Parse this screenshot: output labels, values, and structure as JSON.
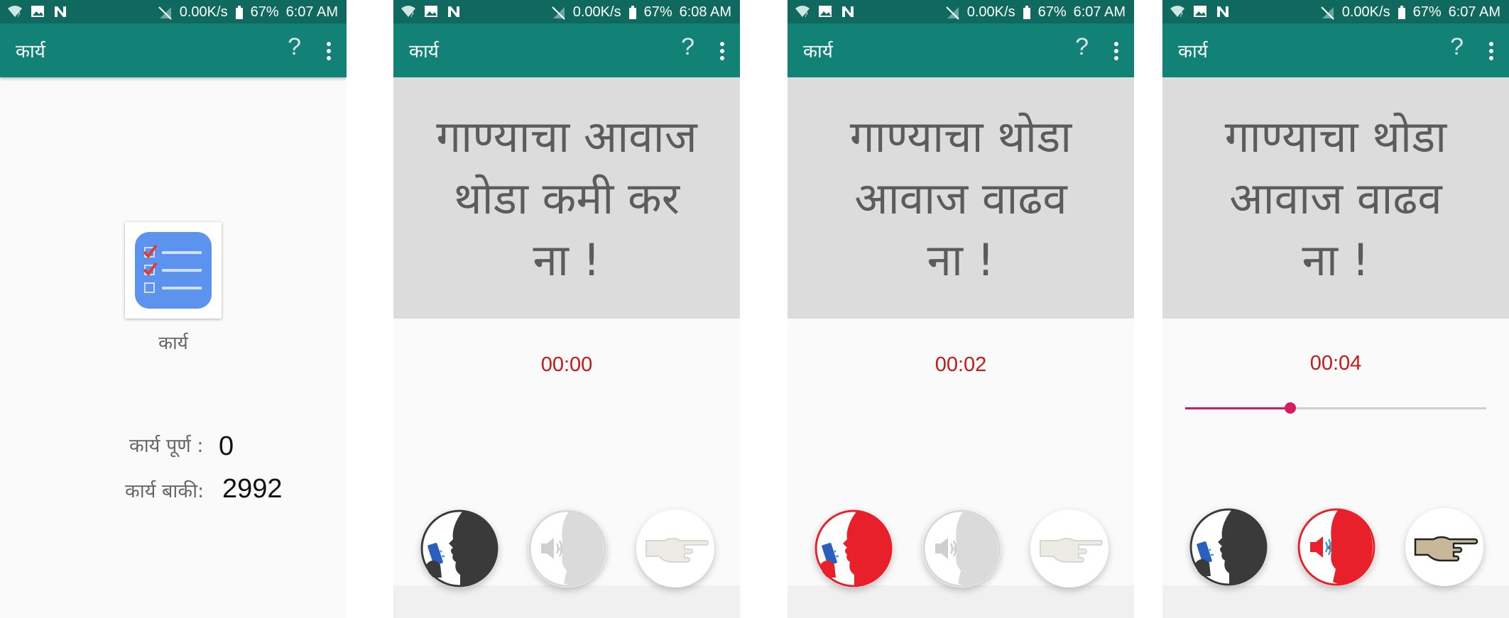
{
  "status_bar": {
    "net_speed": "0.00K/s",
    "battery": "67%",
    "times": [
      "6:07 AM",
      "6:08 AM",
      "6:07 AM",
      "6:07 AM"
    ]
  },
  "app_bar": {
    "title": "कार्य",
    "help_label": "?"
  },
  "screen1": {
    "task_tile_label": "कार्य",
    "completed_label": "कार्य पूर्ण :",
    "completed_value": "0",
    "remaining_label": "कार्य बाकी:",
    "remaining_value": "2992"
  },
  "screen2": {
    "prompt_lines": [
      "गाण्याचा आवाज",
      "थोडा कमी कर",
      "ना !"
    ],
    "timer": "00:00"
  },
  "screen3": {
    "prompt_lines": [
      "गाण्याचा थोडा",
      "आवाज वाढव",
      "ना !"
    ],
    "timer": "00:02"
  },
  "screen4": {
    "prompt_lines": [
      "गाण्याचा थोडा",
      "आवाज वाढव",
      "ना !"
    ],
    "timer": "00:04",
    "playback_progress": 0.35
  },
  "icons": {
    "record": "speaking-head-phone-icon",
    "play": "listening-head-speaker-icon",
    "next": "pointing-hand-icon"
  },
  "colors": {
    "status_bar": "#10695e",
    "app_bar": "#128277",
    "timer": "#c41a1a",
    "active_red": "#e8202a",
    "slider": "#d81b60"
  }
}
